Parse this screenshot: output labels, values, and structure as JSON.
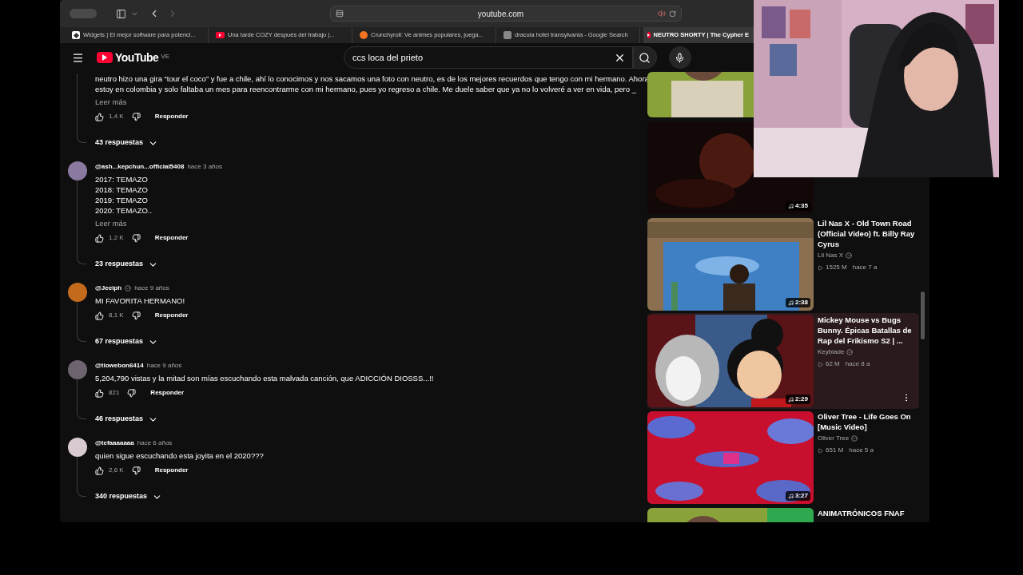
{
  "browser": {
    "url": "youtube.com",
    "tabs": [
      {
        "kind": "widgets",
        "title": "Widgets | El mejor software para potenci...",
        "selected": false
      },
      {
        "kind": "youtube",
        "title": "Una tarde COZY después del trabajo |...",
        "selected": false
      },
      {
        "kind": "crunchyroll",
        "title": "Crunchyroll: Ve animes populares, juega...",
        "selected": false
      },
      {
        "kind": "google",
        "title": "dracula hotel transylvania - Google Search",
        "selected": false
      },
      {
        "kind": "youtube",
        "title": "NEUTRO SHORTY | The Cypher E",
        "selected": true
      }
    ]
  },
  "youtube": {
    "logo": "YouTube",
    "region": "VE",
    "search_value": "ccs loca del prieto"
  },
  "comments": [
    {
      "lines": [
        "neutro hizo una gira “tour el coco” y fue a chile, ahí lo conocimos y nos sacamos una foto con neutro, es de los mejores recuerdos que tengo con mi hermano. Ahora",
        "estoy en colombia y solo faltaba un mes para reencontrarme con mi hermano, pues yo regreso a chile. Me duele saber que ya no lo volveré a ver en vida, pero _"
      ],
      "read_more": "Leer más",
      "likes": "1,4 K",
      "reply": "Responder",
      "replies": "43 respuestas"
    },
    {
      "author": "@ash...kepchun...official5408",
      "verified": false,
      "time": "hace 3 años",
      "color": "#8a7aa0",
      "lines": [
        "2017: TEMAZO",
        "2018: TEMAZO",
        "2019: TEMAZO",
        "2020: TEMAZO.."
      ],
      "read_more": "Leer más",
      "likes": "1,2 K",
      "reply": "Responder",
      "replies": "23 respuestas"
    },
    {
      "author": "@Jeeiph",
      "verified": true,
      "time": "hace 9 años",
      "color": "#c46a1c",
      "lines": [
        "MI FAVORITA HERMANO!"
      ],
      "likes": "8,1 K",
      "reply": "Responder",
      "replies": "67 respuestas"
    },
    {
      "author": "@tiowebon6414",
      "verified": false,
      "time": "hace 9 años",
      "color": "#6e6470",
      "lines": [
        "5,204,790 vistas y la mitad son mías escuchando esta malvada canción, que ADICCIÓN DIOSSS...!!"
      ],
      "likes": "821",
      "reply": "Responder",
      "replies": "46 respuestas"
    },
    {
      "author": "@tefaaaaaaa",
      "verified": false,
      "time": "hace 6 años",
      "color": "#d9c9d0",
      "lines": [
        "quien sigue escuchando esta joyita en el 2020???"
      ],
      "likes": "2,6 K",
      "reply": "Responder",
      "replies": "340 respuestas"
    }
  ],
  "related": [
    {
      "hovered": false
    },
    {
      "hovered": false,
      "duration": "4:35"
    },
    {
      "hovered": false,
      "duration": "2:38",
      "title": "Lil Nas X - Old Town Road (Official Video) ft. Billy Ray Cyrus",
      "channel": "Lil Nas X",
      "verified": true,
      "views": "1525 M",
      "age": "hace 7 a"
    },
    {
      "hovered": true,
      "duration": "2:29",
      "title": "Mickey Mouse vs Bugs Bunny. Épicas Batallas de Rap del Frikismo S2 | ...",
      "channel": "Keyblade",
      "verified": true,
      "views": "62 M",
      "age": "hace 8 a"
    },
    {
      "hovered": false,
      "duration": "3:27",
      "title": "Oliver Tree - Life Goes On [Music Video]",
      "channel": "Oliver Tree",
      "verified": true,
      "views": "651 M",
      "age": "hace 5 a"
    },
    {
      "hovered": false,
      "title": "ANIMATRÓNICOS FNAF"
    }
  ]
}
